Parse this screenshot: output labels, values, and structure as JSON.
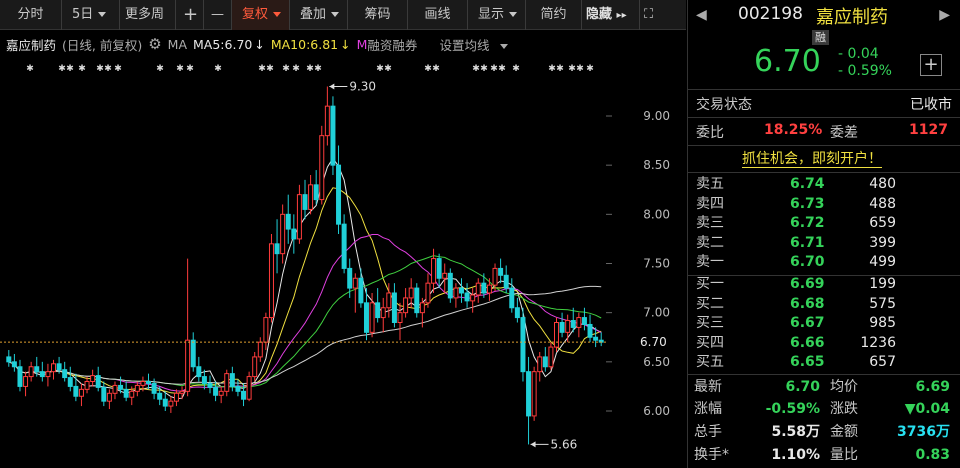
{
  "toolbar": {
    "fenshi": "分时",
    "days5": "5日",
    "more_period": "更多周",
    "plus": "+",
    "minus": "—",
    "fuquan": "复权",
    "diejia": "叠加",
    "chouma": "筹码",
    "huaxian": "画线",
    "xianshi": "显示",
    "jianyue": "简约",
    "hide": "隐藏",
    "hide_arrows": "▸▸",
    "expand": "⛶"
  },
  "info_bar": {
    "name": "嘉应制药",
    "mode": "(日线, 前复权)",
    "gear": "⚙",
    "ma_label": "MA",
    "ma5": "MA5:6.70",
    "ma5_arrow": "↓",
    "ma10": "MA10:6.81",
    "ma10_arrow": "↓",
    "m_label": "M",
    "margin": "融资融券",
    "settings": "设置均线"
  },
  "chart_data": {
    "type": "candlestick",
    "y_ticks": [
      "9.00",
      "8.50",
      "8.00",
      "7.50",
      "7.00",
      "6.50",
      "6.00"
    ],
    "ylim": [
      5.6,
      9.4
    ],
    "current_price_label": "6.70",
    "annotations": [
      {
        "text": "9.30",
        "price": 9.3
      },
      {
        "text": "5.66",
        "price": 5.66
      }
    ],
    "candles": [
      [
        6.55,
        6.62,
        6.45,
        6.5
      ],
      [
        6.5,
        6.58,
        6.4,
        6.45
      ],
      [
        6.45,
        6.52,
        6.2,
        6.25
      ],
      [
        6.25,
        6.4,
        6.15,
        6.35
      ],
      [
        6.35,
        6.5,
        6.3,
        6.45
      ],
      [
        6.45,
        6.55,
        6.35,
        6.4
      ],
      [
        6.4,
        6.5,
        6.3,
        6.35
      ],
      [
        6.35,
        6.48,
        6.25,
        6.4
      ],
      [
        6.4,
        6.52,
        6.32,
        6.48
      ],
      [
        6.48,
        6.55,
        6.38,
        6.42
      ],
      [
        6.42,
        6.5,
        6.3,
        6.34
      ],
      [
        6.34,
        6.45,
        6.2,
        6.25
      ],
      [
        6.25,
        6.38,
        6.1,
        6.15
      ],
      [
        6.15,
        6.28,
        6.05,
        6.22
      ],
      [
        6.22,
        6.35,
        6.18,
        6.3
      ],
      [
        6.3,
        6.42,
        6.25,
        6.36
      ],
      [
        6.36,
        6.45,
        6.2,
        6.24
      ],
      [
        6.24,
        6.3,
        6.05,
        6.1
      ],
      [
        6.1,
        6.22,
        6.02,
        6.18
      ],
      [
        6.18,
        6.3,
        6.12,
        6.26
      ],
      [
        6.26,
        6.35,
        6.18,
        6.22
      ],
      [
        6.22,
        6.3,
        6.1,
        6.14
      ],
      [
        6.14,
        6.25,
        6.06,
        6.2
      ],
      [
        6.2,
        6.3,
        6.15,
        6.26
      ],
      [
        6.26,
        6.35,
        6.2,
        6.3
      ],
      [
        6.3,
        6.38,
        6.22,
        6.28
      ],
      [
        6.28,
        6.33,
        6.12,
        6.18
      ],
      [
        6.18,
        6.25,
        6.06,
        6.12
      ],
      [
        6.12,
        6.2,
        6.0,
        6.05
      ],
      [
        6.05,
        6.15,
        5.98,
        6.1
      ],
      [
        6.1,
        6.22,
        6.05,
        6.18
      ],
      [
        6.18,
        6.25,
        6.12,
        6.2
      ],
      [
        6.2,
        7.55,
        6.15,
        6.72
      ],
      [
        6.72,
        6.8,
        6.4,
        6.45
      ],
      [
        6.45,
        6.55,
        6.3,
        6.35
      ],
      [
        6.35,
        6.42,
        6.22,
        6.28
      ],
      [
        6.28,
        6.36,
        6.18,
        6.24
      ],
      [
        6.24,
        6.3,
        6.1,
        6.16
      ],
      [
        6.16,
        6.25,
        6.08,
        6.2
      ],
      [
        6.2,
        6.42,
        6.15,
        6.38
      ],
      [
        6.38,
        6.45,
        6.2,
        6.25
      ],
      [
        6.25,
        6.32,
        6.15,
        6.2
      ],
      [
        6.2,
        6.28,
        6.05,
        6.12
      ],
      [
        6.12,
        6.4,
        6.1,
        6.35
      ],
      [
        6.35,
        6.6,
        6.3,
        6.55
      ],
      [
        6.55,
        6.75,
        6.5,
        6.7
      ],
      [
        6.7,
        7.0,
        6.62,
        6.95
      ],
      [
        6.95,
        7.8,
        6.9,
        7.7
      ],
      [
        7.7,
        7.95,
        7.4,
        7.6
      ],
      [
        7.6,
        8.1,
        7.5,
        8.0
      ],
      [
        8.0,
        8.2,
        7.7,
        7.85
      ],
      [
        7.85,
        8.0,
        7.6,
        7.75
      ],
      [
        7.75,
        8.3,
        7.7,
        8.2
      ],
      [
        8.2,
        8.35,
        7.95,
        8.05
      ],
      [
        8.05,
        8.4,
        8.0,
        8.3
      ],
      [
        8.3,
        8.45,
        8.1,
        8.15
      ],
      [
        8.15,
        8.9,
        8.1,
        8.8
      ],
      [
        8.8,
        9.3,
        8.7,
        9.1
      ],
      [
        9.1,
        9.2,
        8.4,
        8.5
      ],
      [
        8.5,
        8.7,
        7.8,
        7.9
      ],
      [
        7.9,
        8.0,
        7.4,
        7.45
      ],
      [
        7.45,
        7.55,
        7.15,
        7.25
      ],
      [
        7.25,
        7.4,
        7.0,
        7.35
      ],
      [
        7.35,
        7.45,
        7.05,
        7.1
      ],
      [
        7.1,
        7.25,
        6.72,
        6.8
      ],
      [
        6.8,
        7.2,
        6.75,
        7.1
      ],
      [
        7.1,
        7.25,
        6.9,
        6.95
      ],
      [
        6.95,
        7.15,
        6.8,
        7.05
      ],
      [
        7.05,
        7.3,
        6.95,
        7.2
      ],
      [
        7.2,
        7.3,
        6.85,
        6.9
      ],
      [
        6.9,
        7.1,
        6.72,
        7.0
      ],
      [
        7.0,
        7.25,
        6.95,
        7.15
      ],
      [
        7.15,
        7.35,
        7.05,
        7.25
      ],
      [
        7.25,
        7.3,
        6.95,
        7.0
      ],
      [
        7.0,
        7.15,
        6.85,
        7.1
      ],
      [
        7.1,
        7.4,
        7.05,
        7.3
      ],
      [
        7.3,
        7.65,
        7.2,
        7.55
      ],
      [
        7.55,
        7.6,
        7.25,
        7.35
      ],
      [
        7.35,
        7.5,
        7.2,
        7.4
      ],
      [
        7.4,
        7.45,
        7.1,
        7.15
      ],
      [
        7.15,
        7.3,
        7.05,
        7.25
      ],
      [
        7.25,
        7.35,
        7.1,
        7.2
      ],
      [
        7.2,
        7.3,
        7.05,
        7.12
      ],
      [
        7.12,
        7.25,
        7.0,
        7.18
      ],
      [
        7.18,
        7.35,
        7.1,
        7.3
      ],
      [
        7.3,
        7.4,
        7.15,
        7.2
      ],
      [
        7.2,
        7.35,
        7.12,
        7.28
      ],
      [
        7.28,
        7.5,
        7.22,
        7.45
      ],
      [
        7.45,
        7.55,
        7.3,
        7.38
      ],
      [
        7.38,
        7.48,
        7.2,
        7.25
      ],
      [
        7.25,
        7.35,
        7.0,
        7.05
      ],
      [
        7.05,
        7.15,
        6.9,
        6.95
      ],
      [
        6.95,
        7.05,
        6.3,
        6.4
      ],
      [
        6.4,
        6.55,
        5.66,
        5.95
      ],
      [
        5.95,
        6.45,
        5.9,
        6.4
      ],
      [
        6.4,
        6.6,
        6.3,
        6.55
      ],
      [
        6.55,
        6.65,
        6.4,
        6.45
      ],
      [
        6.45,
        6.7,
        6.42,
        6.65
      ],
      [
        6.65,
        6.95,
        6.6,
        6.9
      ],
      [
        6.9,
        7.0,
        6.75,
        6.8
      ],
      [
        6.8,
        6.98,
        6.7,
        6.92
      ],
      [
        6.92,
        7.05,
        6.8,
        6.85
      ],
      [
        6.85,
        7.0,
        6.75,
        6.95
      ],
      [
        6.95,
        7.05,
        6.82,
        6.88
      ],
      [
        6.88,
        6.98,
        6.7,
        6.75
      ],
      [
        6.75,
        6.85,
        6.65,
        6.72
      ],
      [
        6.72,
        6.8,
        6.66,
        6.7
      ]
    ]
  },
  "panel": {
    "nav_prev": "◀",
    "nav_next": "▶",
    "code": "002198",
    "name": "嘉应制药",
    "badge": "融",
    "price": "6.70",
    "change": "- 0.04",
    "change_pct": "- 0.59%",
    "add": "+",
    "trade_status_label": "交易状态",
    "trade_status_value": "已收市",
    "weibi_label": "委比",
    "weibi_value": "18.25%",
    "weicha_label": "委差",
    "weicha_value": "1127",
    "ad_text": "抓住机会，即刻开户！",
    "asks": [
      {
        "label": "卖五",
        "price": "6.74",
        "vol": "480"
      },
      {
        "label": "卖四",
        "price": "6.73",
        "vol": "488"
      },
      {
        "label": "卖三",
        "price": "6.72",
        "vol": "659"
      },
      {
        "label": "卖二",
        "price": "6.71",
        "vol": "399"
      },
      {
        "label": "卖一",
        "price": "6.70",
        "vol": "499"
      }
    ],
    "bids": [
      {
        "label": "买一",
        "price": "6.69",
        "vol": "199"
      },
      {
        "label": "买二",
        "price": "6.68",
        "vol": "575"
      },
      {
        "label": "买三",
        "price": "6.67",
        "vol": "985"
      },
      {
        "label": "买四",
        "price": "6.66",
        "vol": "1236"
      },
      {
        "label": "买五",
        "price": "6.65",
        "vol": "657"
      }
    ],
    "stats": {
      "latest_label": "最新",
      "latest_value": "6.70",
      "avg_label": "均价",
      "avg_value": "6.69",
      "pct_label": "涨幅",
      "pct_value": "-0.59%",
      "chg_label": "涨跌",
      "chg_value": "▼0.04",
      "vol_label": "总手",
      "vol_value": "5.58万",
      "amt_label": "金额",
      "amt_value": "3736万",
      "turn_label": "换手*",
      "turn_value": "1.10%",
      "ratio_label": "量比",
      "ratio_value": "0.83"
    }
  }
}
